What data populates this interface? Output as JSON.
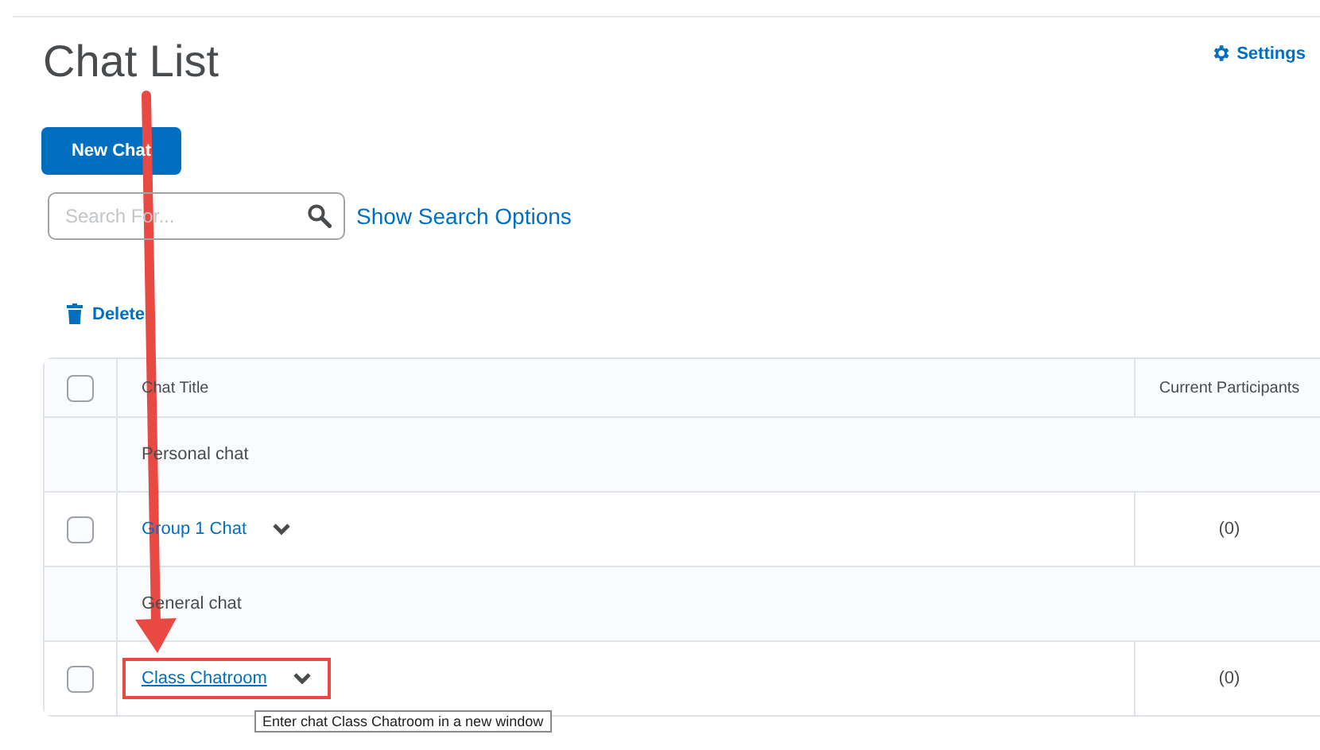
{
  "page": {
    "title": "Chat List",
    "settings_link": "Settings"
  },
  "toolbar": {
    "new_button": "New Chat",
    "search": {
      "placeholder": "Search For..."
    },
    "search_options_link": "Show Search Options",
    "delete_action": "Delete"
  },
  "table": {
    "columns": [
      "Chat Title",
      "Current Participants"
    ],
    "header_checked": false,
    "rows": [
      {
        "kind": "group",
        "title": "Personal chat"
      },
      {
        "kind": "chat",
        "title": "Group 1 Chat",
        "participants": "(0)",
        "checked": false,
        "highlighted": false
      },
      {
        "kind": "group",
        "title": "General chat"
      },
      {
        "kind": "chat",
        "title": "Class Chatroom",
        "participants": "(0)",
        "checked": false,
        "highlighted": true,
        "tooltip": "Enter chat Class Chatroom in a new window"
      }
    ]
  },
  "annotation": {
    "arrow": true
  }
}
